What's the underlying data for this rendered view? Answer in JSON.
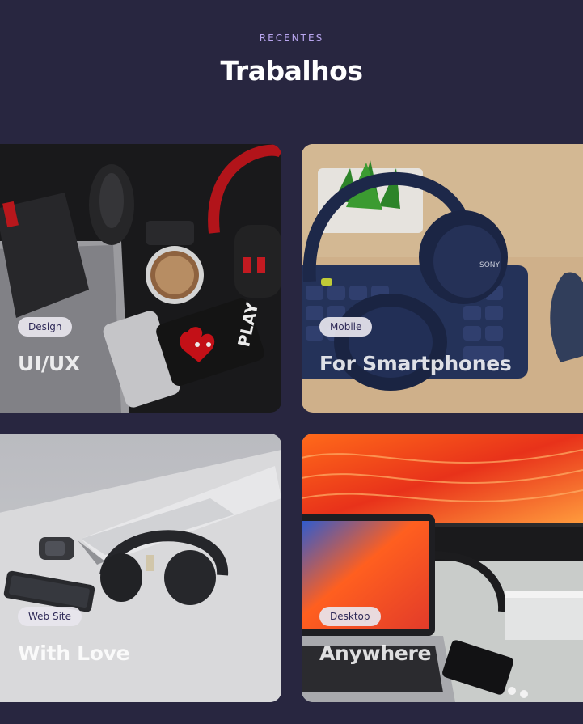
{
  "section": {
    "eyebrow": "RECENTES",
    "title": "Trabalhos"
  },
  "projects": [
    {
      "tag": "Design",
      "caption": "UI/UX",
      "photo": "desk-gadgets-dark-photo"
    },
    {
      "tag": "Mobile",
      "caption": "For Smartphones",
      "photo": "headphones-keyboard-photo"
    },
    {
      "tag": "Web Site",
      "caption": "With Love",
      "photo": "laptop-headphones-photo"
    },
    {
      "tag": "Desktop",
      "caption": "Anywhere",
      "photo": "monitor-laptop-photo"
    }
  ],
  "colors": {
    "background": "#282640",
    "eyebrow": "#b9a6f0",
    "tag_bg": "#e8e6ee",
    "tag_text": "#2f2a58"
  }
}
